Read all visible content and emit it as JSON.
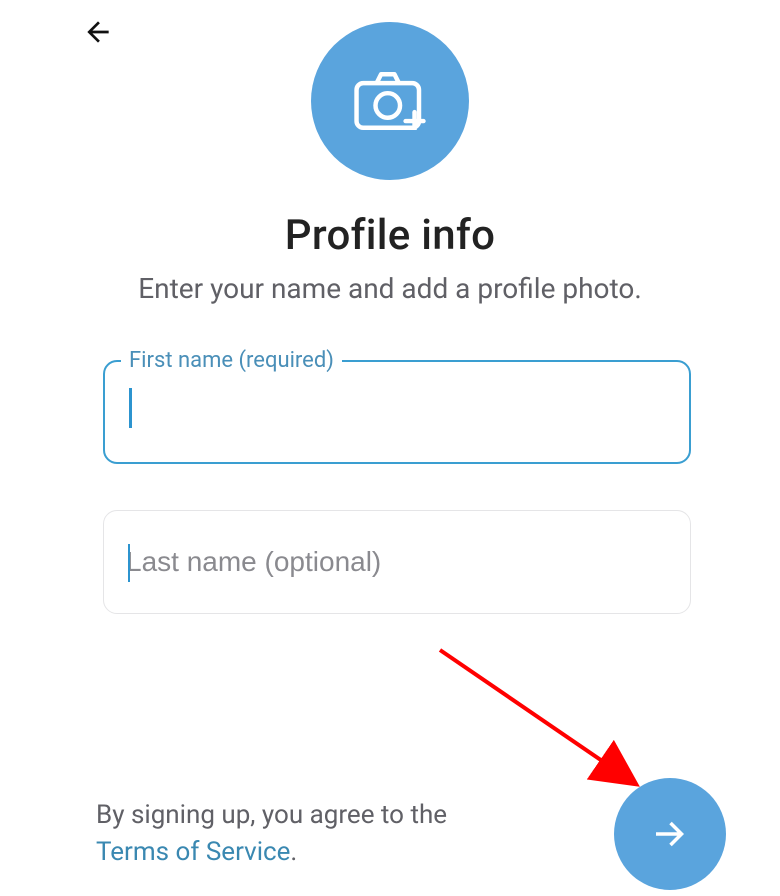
{
  "header": {
    "back_aria": "Back"
  },
  "avatar": {
    "add_photo_aria": "Add profile photo"
  },
  "title": "Profile info",
  "subtitle": "Enter your name and add a profile photo.",
  "fields": {
    "first": {
      "label": "First name (required)",
      "value": ""
    },
    "last": {
      "placeholder": "Last name (optional)",
      "value": ""
    }
  },
  "footer": {
    "part1": "By signing up, you agree to the ",
    "tos_link": "Terms of Service",
    "part2": "."
  },
  "fab": {
    "next_aria": "Next"
  },
  "colors": {
    "accent": "#5aa4dd",
    "border_focus": "#3a9ed1",
    "text_muted": "#606066",
    "placeholder": "#8a8a8f"
  }
}
